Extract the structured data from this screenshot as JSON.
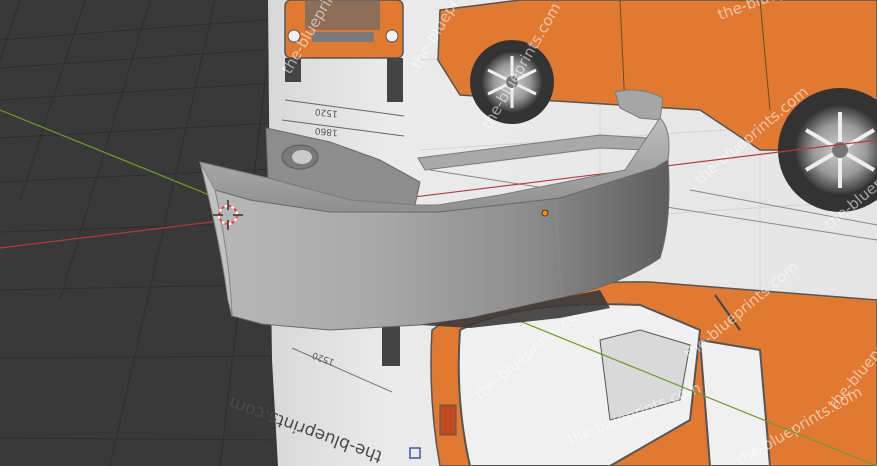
{
  "app": "3D Viewport",
  "viewport": {
    "background_color": "#393939",
    "grid_color": "#2b2b2b",
    "x_axis_color": "#b23a3a",
    "y_axis_color": "#6f9a2a"
  },
  "reference_image": {
    "panel_color": "#e9e9e9",
    "car_color": "#e07a33",
    "site_label": "the-blueprints.com",
    "watermark": "the-blueprints.com",
    "dimensions": {
      "front_width_1": "1520",
      "front_width_2": "1860",
      "top_width": "1520"
    }
  },
  "model": {
    "name": "Front Bumper",
    "material_color": "#9a9a9a",
    "origin_color": "#ff8c00"
  },
  "cursor": {
    "name": "3D Cursor",
    "ring_colors": [
      "#ff3b3b",
      "#ffffff"
    ]
  }
}
